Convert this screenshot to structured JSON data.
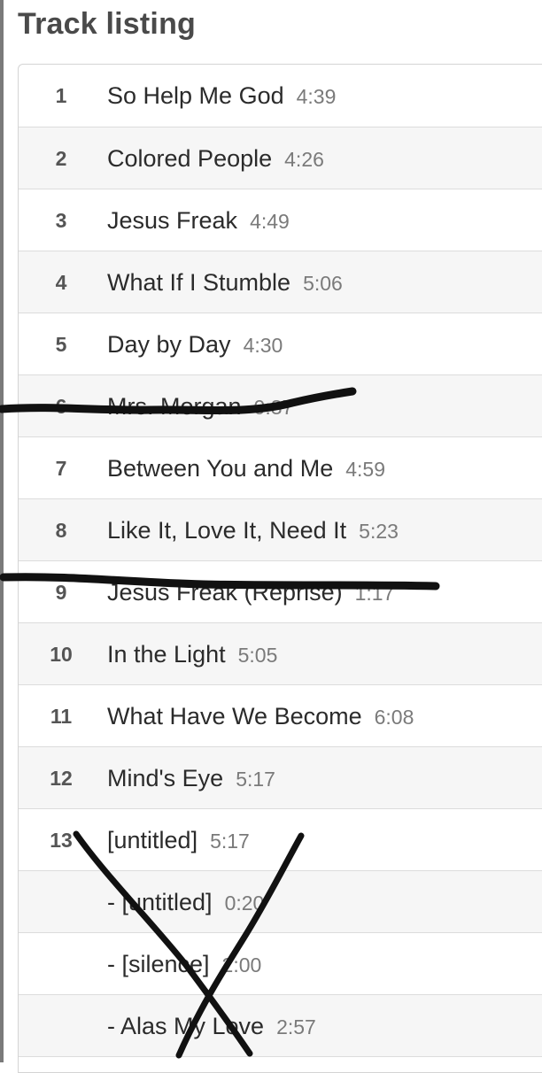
{
  "page": {
    "title": "Track listing"
  },
  "tracks": [
    {
      "number": "1",
      "name": "So Help Me God",
      "duration": "4:39"
    },
    {
      "number": "2",
      "name": "Colored People",
      "duration": "4:26"
    },
    {
      "number": "3",
      "name": "Jesus Freak",
      "duration": "4:49"
    },
    {
      "number": "4",
      "name": "What If I Stumble",
      "duration": "5:06"
    },
    {
      "number": "5",
      "name": "Day by Day",
      "duration": "4:30"
    },
    {
      "number": "6",
      "name": "Mrs. Morgan",
      "duration": "0:37"
    },
    {
      "number": "7",
      "name": "Between You and Me",
      "duration": "4:59"
    },
    {
      "number": "8",
      "name": "Like It, Love It, Need It",
      "duration": "5:23"
    },
    {
      "number": "9",
      "name": "Jesus Freak (Reprise)",
      "duration": "1:17"
    },
    {
      "number": "10",
      "name": "In the Light",
      "duration": "5:05"
    },
    {
      "number": "11",
      "name": "What Have We Become",
      "duration": "6:08"
    },
    {
      "number": "12",
      "name": "Mind's Eye",
      "duration": "5:17"
    },
    {
      "number": "13",
      "name": "[untitled]",
      "duration": "5:17"
    },
    {
      "number": "",
      "name": "- [untitled]",
      "duration": "0:20"
    },
    {
      "number": "",
      "name": "- [silence]",
      "duration": "2:00"
    },
    {
      "number": "",
      "name": "- Alas My Love",
      "duration": "2:57"
    }
  ],
  "colors": {
    "title": "#4a4a4a",
    "row_alt": "#f6f6f6",
    "ink": "#111111"
  }
}
